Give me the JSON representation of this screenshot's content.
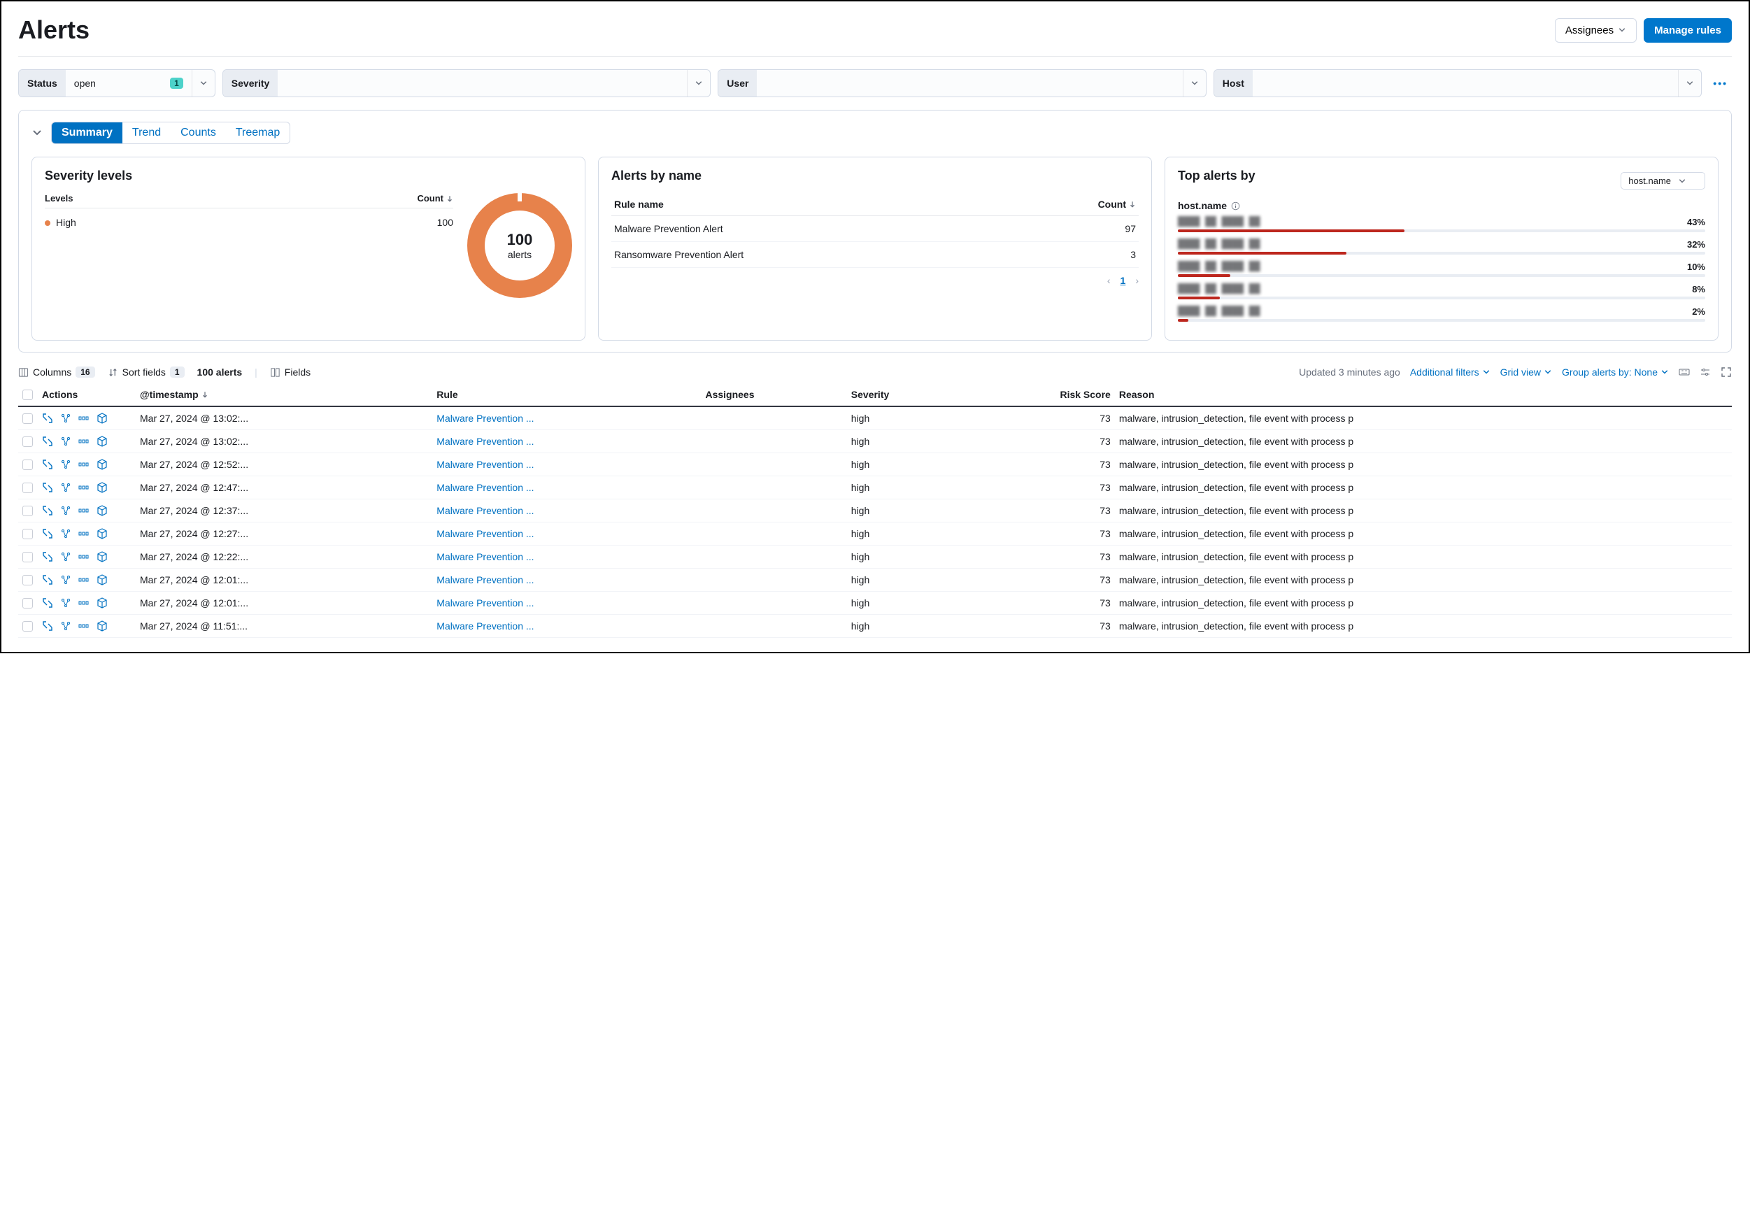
{
  "page": {
    "title": "Alerts"
  },
  "header_actions": {
    "assignees": "Assignees",
    "manage_rules": "Manage rules"
  },
  "filters": {
    "status": {
      "label": "Status",
      "value": "open",
      "badge": "1"
    },
    "severity": {
      "label": "Severity",
      "value": ""
    },
    "user": {
      "label": "User",
      "value": ""
    },
    "host": {
      "label": "Host",
      "value": ""
    }
  },
  "tabs": {
    "summary": "Summary",
    "trend": "Trend",
    "counts": "Counts",
    "treemap": "Treemap"
  },
  "severity_card": {
    "title": "Severity levels",
    "col_levels": "Levels",
    "col_count": "Count",
    "rows": [
      {
        "level": "High",
        "count": "100"
      }
    ],
    "donut_total": "100",
    "donut_label": "alerts"
  },
  "alerts_by_name": {
    "title": "Alerts by name",
    "col_rule": "Rule name",
    "col_count": "Count",
    "rows": [
      {
        "name": "Malware Prevention Alert",
        "count": "97"
      },
      {
        "name": "Ransomware Prevention Alert",
        "count": "3"
      }
    ],
    "page": "1"
  },
  "top_alerts": {
    "title": "Top alerts by",
    "select": "host.name",
    "field_label": "host.name",
    "rows": [
      {
        "pct": "43%",
        "width": 43
      },
      {
        "pct": "32%",
        "width": 32
      },
      {
        "pct": "10%",
        "width": 10
      },
      {
        "pct": "8%",
        "width": 8
      },
      {
        "pct": "2%",
        "width": 2
      }
    ]
  },
  "toolbar": {
    "columns": "Columns",
    "columns_count": "16",
    "sort": "Sort fields",
    "sort_count": "1",
    "total": "100 alerts",
    "fields": "Fields",
    "updated": "Updated 3 minutes ago",
    "additional": "Additional filters",
    "grid": "Grid view",
    "group": "Group alerts by: None"
  },
  "table": {
    "headers": {
      "actions": "Actions",
      "timestamp": "@timestamp",
      "rule": "Rule",
      "assignees": "Assignees",
      "severity": "Severity",
      "risk": "Risk Score",
      "reason": "Reason"
    },
    "rows": [
      {
        "ts": "Mar 27, 2024 @ 13:02:...",
        "rule": "Malware Prevention ...",
        "sev": "high",
        "risk": "73",
        "reason": "malware, intrusion_detection, file event with process p"
      },
      {
        "ts": "Mar 27, 2024 @ 13:02:...",
        "rule": "Malware Prevention ...",
        "sev": "high",
        "risk": "73",
        "reason": "malware, intrusion_detection, file event with process p"
      },
      {
        "ts": "Mar 27, 2024 @ 12:52:...",
        "rule": "Malware Prevention ...",
        "sev": "high",
        "risk": "73",
        "reason": "malware, intrusion_detection, file event with process p"
      },
      {
        "ts": "Mar 27, 2024 @ 12:47:...",
        "rule": "Malware Prevention ...",
        "sev": "high",
        "risk": "73",
        "reason": "malware, intrusion_detection, file event with process p"
      },
      {
        "ts": "Mar 27, 2024 @ 12:37:...",
        "rule": "Malware Prevention ...",
        "sev": "high",
        "risk": "73",
        "reason": "malware, intrusion_detection, file event with process p"
      },
      {
        "ts": "Mar 27, 2024 @ 12:27:...",
        "rule": "Malware Prevention ...",
        "sev": "high",
        "risk": "73",
        "reason": "malware, intrusion_detection, file event with process p"
      },
      {
        "ts": "Mar 27, 2024 @ 12:22:...",
        "rule": "Malware Prevention ...",
        "sev": "high",
        "risk": "73",
        "reason": "malware, intrusion_detection, file event with process p"
      },
      {
        "ts": "Mar 27, 2024 @ 12:01:...",
        "rule": "Malware Prevention ...",
        "sev": "high",
        "risk": "73",
        "reason": "malware, intrusion_detection, file event with process p"
      },
      {
        "ts": "Mar 27, 2024 @ 12:01:...",
        "rule": "Malware Prevention ...",
        "sev": "high",
        "risk": "73",
        "reason": "malware, intrusion_detection, file event with process p"
      },
      {
        "ts": "Mar 27, 2024 @ 11:51:...",
        "rule": "Malware Prevention ...",
        "sev": "high",
        "risk": "73",
        "reason": "malware, intrusion_detection, file event with process p"
      }
    ]
  },
  "chart_data": {
    "donut": {
      "type": "pie",
      "title": "Severity levels",
      "series": [
        {
          "name": "High",
          "value": 100
        }
      ],
      "total": 100,
      "label": "alerts"
    },
    "bars": {
      "type": "bar",
      "title": "Top alerts by host.name",
      "xlabel": "host.name",
      "ylabel": "percent",
      "categories": [
        "host1",
        "host2",
        "host3",
        "host4",
        "host5"
      ],
      "values": [
        43,
        32,
        10,
        8,
        2
      ]
    }
  }
}
